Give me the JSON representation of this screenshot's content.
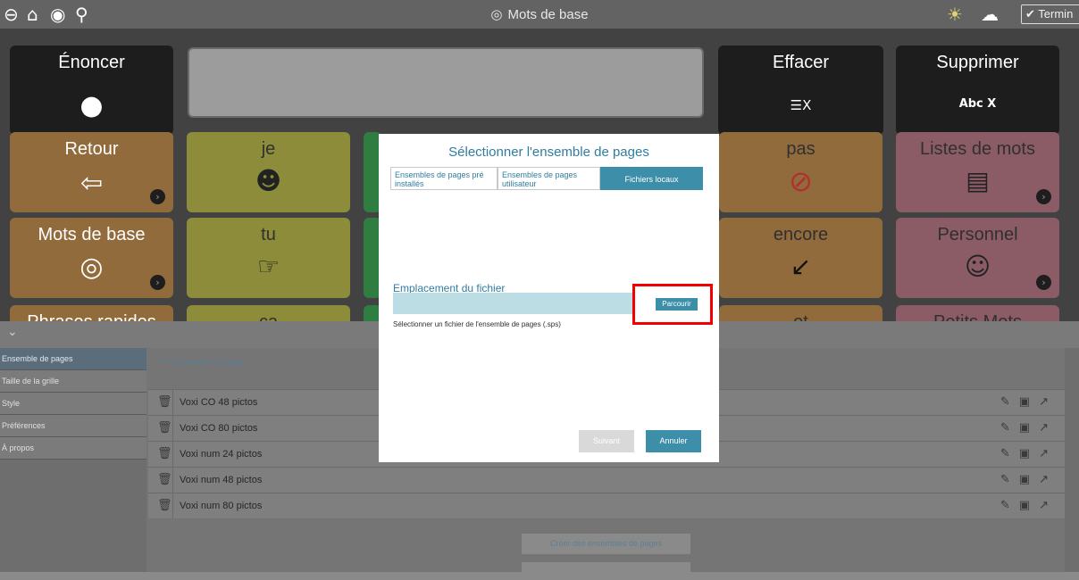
{
  "topbar": {
    "title": "Mots de base",
    "finish_label": "Termin",
    "icons": [
      "back-icon",
      "home-icon",
      "speedometer-icon",
      "search-icon",
      "lightbulb-icon",
      "cloud-sync-icon",
      "check-icon"
    ]
  },
  "board": {
    "speak_label": "Énoncer",
    "clear_label": "Effacer",
    "clear_icon_text": "☰X",
    "delete_label": "Supprimer",
    "delete_icon_text": "Abc X",
    "cells": {
      "retour": "Retour",
      "je": "je",
      "pas": "pas",
      "listes": "Listes de mots",
      "mots_de_base": "Mots de base",
      "tu": "tu",
      "encore": "encore",
      "personnel": "Personnel",
      "phrases": "Phrases rapides",
      "ca": "ça",
      "et": "et",
      "petits": "Petits Mots"
    }
  },
  "settings": {
    "nav": [
      "Ensemble de pages",
      "Taille de la grille",
      "Style",
      "Préférences",
      "À propos"
    ],
    "active_nav": "Ensemble de pages",
    "breadcrumb": "Ensemble de pages",
    "rows": [
      "Voxi CO 48 pictos",
      "Voxi CO 80 pictos",
      "Voxi num 24 pictos",
      "Voxi num 48 pictos",
      "Voxi num 80 pictos"
    ],
    "create_button": "Créer des ensembles de pages"
  },
  "dialog": {
    "title": "Sélectionner l'ensemble de pages",
    "tabs": [
      "Ensembles de pages pré installés",
      "Ensembles de pages utilisateur",
      "Fichiers locaux"
    ],
    "active_tab": "Fichiers locaux",
    "location_label": "Emplacement du fichier",
    "location_value": "",
    "browse_button": "Parcourir",
    "hint": "Sélectionner un fichier de l'ensemble de  pages (.sps)",
    "next_button": "Suivant",
    "cancel_button": "Annuler"
  },
  "colors": {
    "accent": "#3d8ea8",
    "highlight": "#f20000"
  }
}
